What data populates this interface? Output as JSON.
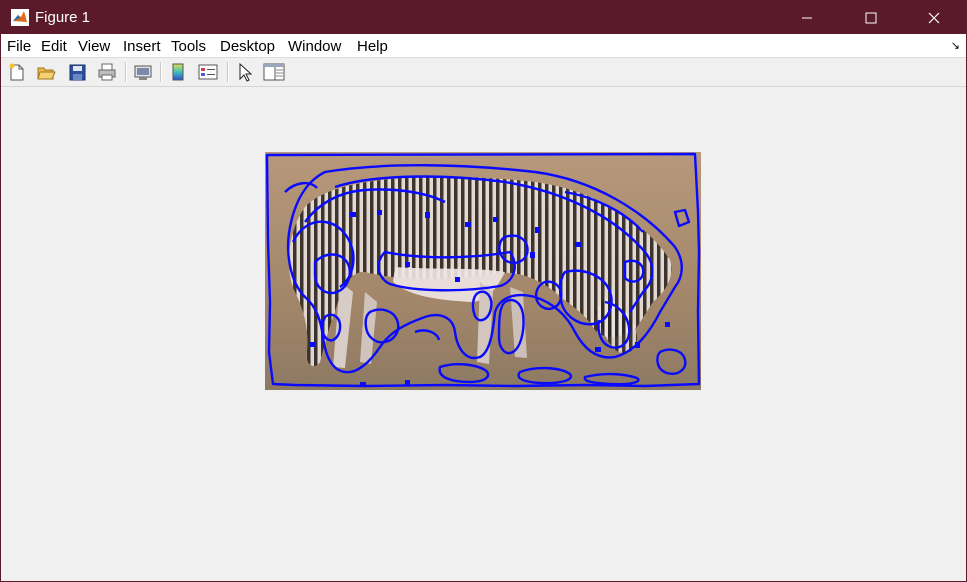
{
  "window": {
    "title": "Figure 1",
    "titlebar_color": "#5a1a2a",
    "controls": {
      "minimize_icon": "minimize-icon",
      "maximize_icon": "maximize-icon",
      "close_icon": "close-icon"
    }
  },
  "menu": {
    "items": [
      "File",
      "Edit",
      "View",
      "Insert",
      "Tools",
      "Desktop",
      "Window",
      "Help"
    ],
    "dock_icon": "dock-arrow-icon",
    "dock_glyph": "↘"
  },
  "toolbar": {
    "buttons": [
      "new-figure-icon",
      "open-file-icon",
      "save-figure-icon",
      "print-figure-icon",
      "link-plot-icon",
      "insert-colorbar-icon",
      "insert-legend-icon",
      "edit-plot-icon",
      "property-inspector-icon"
    ]
  },
  "figure": {
    "image": "zebra-grazing-with-blue-edge-contours",
    "contour_color": "#0a0aff",
    "background_color": "#a58a6a"
  }
}
